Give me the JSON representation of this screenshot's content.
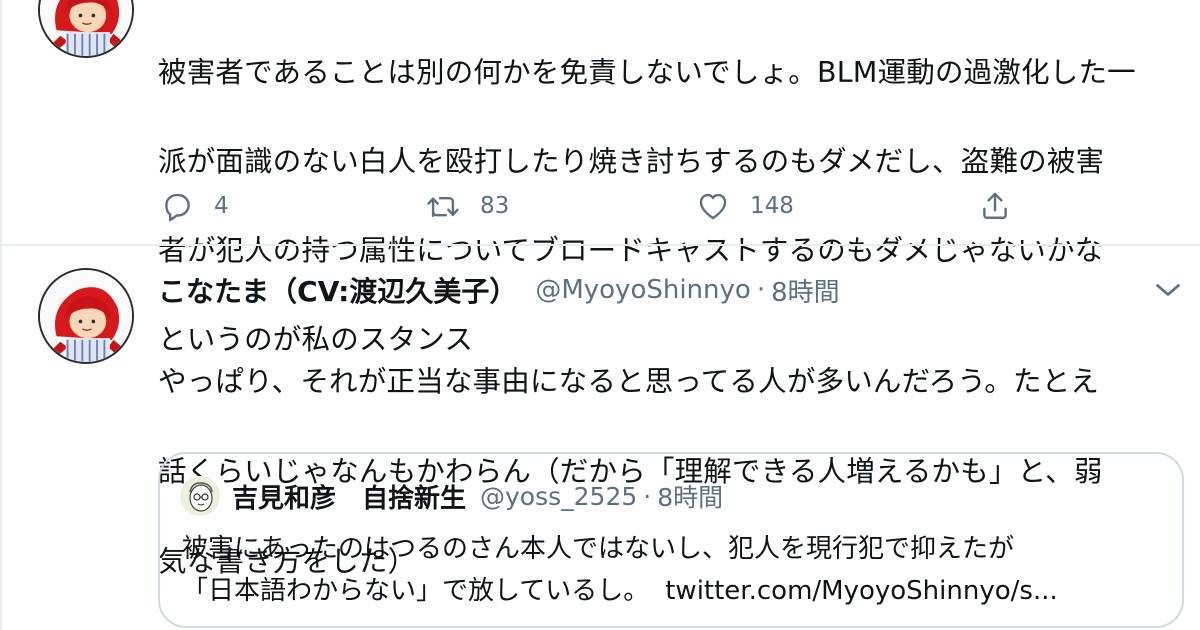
{
  "tweet1": {
    "text_lines": [
      "被害者であることは別の何かを免責しないでしょ。BLM運動の過激化した一",
      "派が面識のない白人を殴打したり焼き討ちするのもダメだし、盗難の被害",
      "者が犯人の持つ属性についてブロードキャストするのもダメじゃないかな",
      "というのが私のスタンス"
    ],
    "reply_count": "4",
    "retweet_count": "83",
    "like_count": "148"
  },
  "tweet2": {
    "display_name": "こなたま（CV:渡辺久美子）",
    "handle": "@MyoyoShinnyo",
    "separator": "·",
    "time": "8時間",
    "text_lines": [
      "やっぱり、それが正当な事由になると思ってる人が多いんだろう。たとえ",
      "話くらいじゃなんもかわらん（だから「理解できる人増えるかも」と、弱",
      "気な書き方をした）"
    ],
    "quote": {
      "display_name": "吉見和彦　自捨新生",
      "handle": "@yoss_2525",
      "separator": "·",
      "time": "8時間",
      "line1": "被害にあったのはつるのさん本人ではないし、犯人を現行犯で抑えたが",
      "line2": "「日本語わからない」で放しているし。",
      "link": "twitter.com/MyoyoShinnyo/s..."
    }
  },
  "icons": {
    "reply": "reply-icon",
    "retweet": "retweet-icon",
    "like": "heart-icon",
    "share": "share-icon",
    "more": "chevron-down-icon"
  },
  "colors": {
    "text": "#0f1419",
    "secondary": "#5b7083",
    "border": "#cfd9de",
    "divider": "#e6ecf0"
  }
}
